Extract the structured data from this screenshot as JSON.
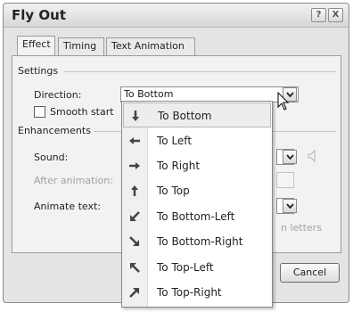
{
  "dialog": {
    "title": "Fly Out",
    "help_label": "?",
    "close_label": "X"
  },
  "tabs": [
    {
      "label": "Effect",
      "active": true
    },
    {
      "label": "Timing",
      "active": false
    },
    {
      "label": "Text Animation",
      "active": false
    }
  ],
  "settings": {
    "group_label": "Settings",
    "direction_label": "Direction:",
    "direction_value": "To Bottom",
    "smooth_start_label": "Smooth start"
  },
  "enhancements": {
    "group_label": "Enhancements",
    "sound_label": "Sound:",
    "after_animation_label": "After animation:",
    "animate_text_label": "Animate text:",
    "letters_fragment": "n letters"
  },
  "buttons": {
    "cancel_label": "Cancel"
  },
  "direction_menu": {
    "items": [
      {
        "label": "To Bottom",
        "icon": "arrow-down-icon",
        "selected": true
      },
      {
        "label": "To Left",
        "icon": "arrow-left-icon",
        "selected": false
      },
      {
        "label": "To Right",
        "icon": "arrow-right-icon",
        "selected": false
      },
      {
        "label": "To Top",
        "icon": "arrow-up-icon",
        "selected": false
      },
      {
        "label": "To Bottom-Left",
        "icon": "arrow-down-left-icon",
        "selected": false
      },
      {
        "label": "To Bottom-Right",
        "icon": "arrow-down-right-icon",
        "selected": false
      },
      {
        "label": "To Top-Left",
        "icon": "arrow-up-left-icon",
        "selected": false
      },
      {
        "label": "To Top-Right",
        "icon": "arrow-up-right-icon",
        "selected": false
      }
    ]
  }
}
